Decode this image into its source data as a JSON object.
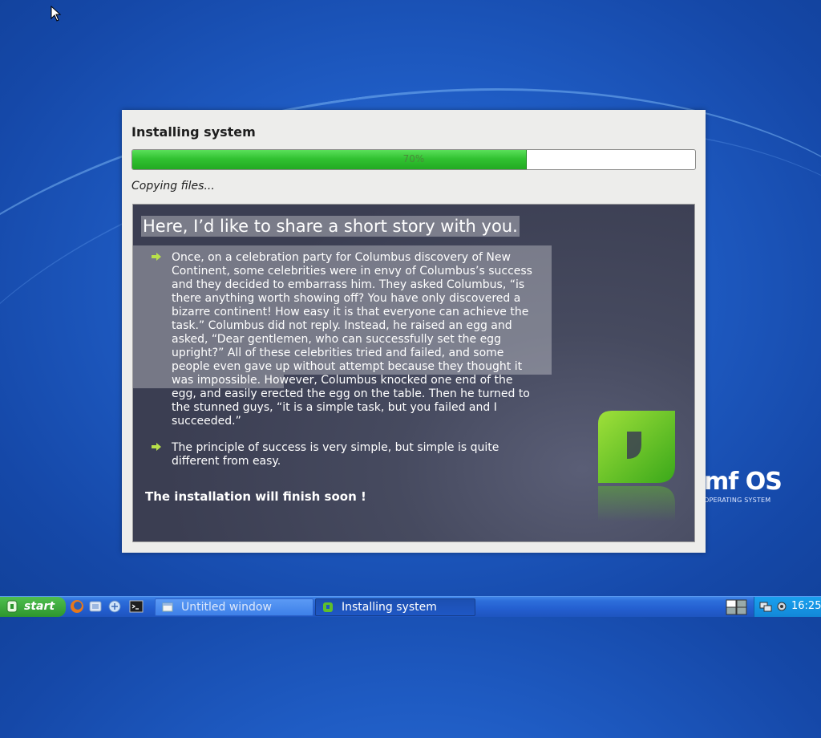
{
  "installer": {
    "title": "Installing system",
    "progress_percent": 70,
    "progress_label": "70%",
    "status": "Copying files..."
  },
  "slide": {
    "heading": "Here, I’d like to share a short story with you.",
    "paragraphs": [
      "Once, on a celebration party for Columbus discovery of New Continent, some celebrities were in envy of Columbus’s success and they decided to embarrass him. They asked Columbus, “is there anything worth showing off? You have only discovered a bizarre continent! How easy it is that everyone can achieve the task.” Columbus did not reply. Instead, he raised an egg and asked, “Dear gentlemen, who can successfully set the egg upright?” All of these celebrities tried and failed, and some people even gave up without attempt because they thought it was impossible. However, Columbus knocked one end of the egg, and easily erected the egg on the table. Then he turned to the stunned guys, “it is a simple task, but you failed and I succeeded.”",
      "The principle of success is very simple, but simple is quite different from easy."
    ],
    "finish_note": "The installation will finish soon !"
  },
  "desktop": {
    "brand_name": "mf OS",
    "brand_tagline": "OPERATING SYSTEM"
  },
  "taskbar": {
    "start_label": "start",
    "tasks": [
      {
        "label": "Untitled window",
        "icon": "window-icon"
      },
      {
        "label": "Installing system",
        "icon": "installer-icon"
      }
    ],
    "clock": "16:25"
  },
  "colors": {
    "progress_fill": "#31c231",
    "slide_bg": "#464a5f",
    "taskbar": "#245fd0",
    "desktop": "#1f5cc4"
  }
}
